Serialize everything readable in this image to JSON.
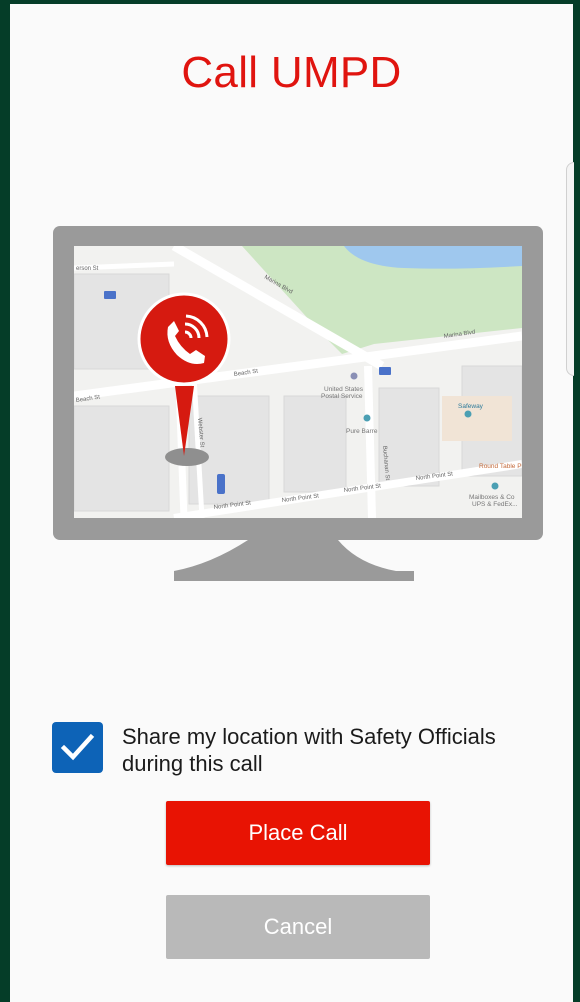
{
  "dialog": {
    "title": "Call UMPD",
    "share_location_label": "Share my location with Safety Officials during this call",
    "share_location_checked": true,
    "place_call_label": "Place Call",
    "cancel_label": "Cancel"
  },
  "map": {
    "streets": {
      "marina_blvd_upper": "Marina Blvd",
      "marina_blvd_right": "Marina Blvd",
      "beach_st_left": "Beach St",
      "beach_st_mid": "Beach St",
      "north_point_st_1": "North Point St",
      "north_point_st_2": "North Point St",
      "north_point_st_3": "North Point St",
      "north_point_st_4": "North Point St",
      "buchanan_st": "Buchanan St",
      "webster_st": "Webster St",
      "jefferson_st": "erson St"
    },
    "places": {
      "usps_line1": "United States",
      "usps_line2": "Postal Service",
      "pure_barre": "Pure Barre",
      "safeway": "Safeway",
      "round_table": "Round Table Pi",
      "mailboxes_line1": "Mailboxes & Co",
      "mailboxes_line2": "UPS & FedEx..."
    }
  },
  "colors": {
    "title": "#e0140f",
    "place_call": "#e81303",
    "cancel": "#b9b9b9",
    "checkbox": "#0d63b7",
    "background": "#053d28"
  },
  "icons": {
    "pin": "phone-location-pin",
    "checkbox": "check-icon"
  }
}
